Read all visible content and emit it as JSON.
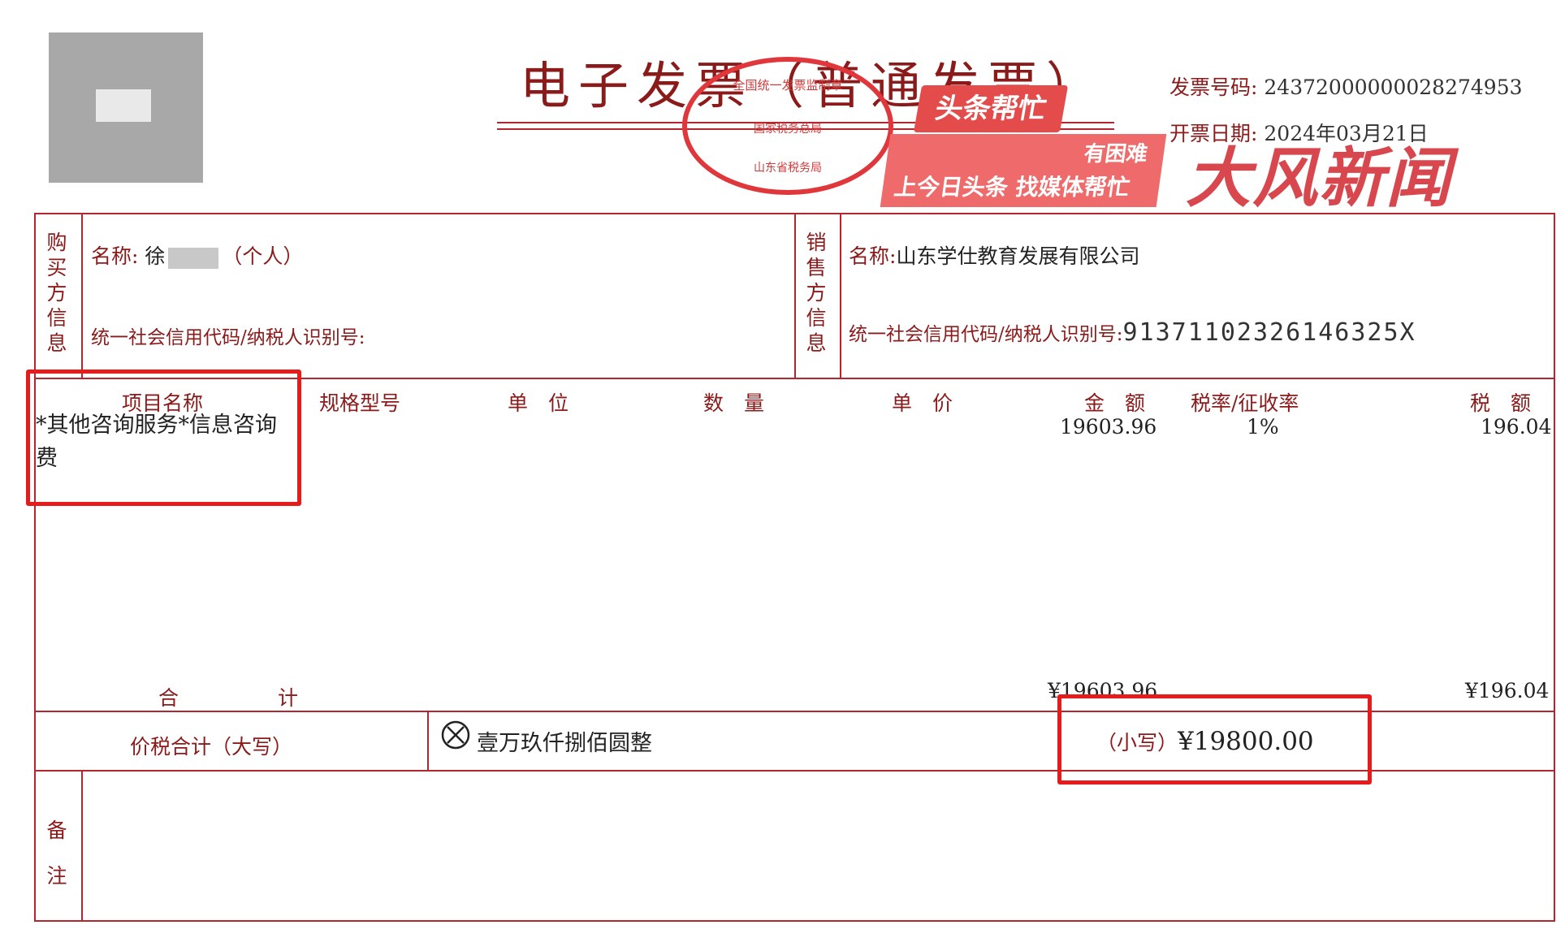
{
  "header": {
    "title": "电子发票（普通发票）",
    "invoice_no_label": "发票号码:",
    "invoice_no": "24372000000028274953",
    "issue_date_label": "开票日期:",
    "issue_date": "2024年03月21日"
  },
  "seal": {
    "line1": "全国统一发票监制章",
    "line2": "国家税务总局",
    "line3": "山东省税务局"
  },
  "watermark": {
    "badge": "头条帮忙",
    "line1": "有困难",
    "line2": "上今日头条 找媒体帮忙",
    "brand": "大风新闻"
  },
  "buyer": {
    "section_label": [
      "购",
      "买",
      "方",
      "信",
      "息"
    ],
    "name_label": "名称:",
    "name_prefix": "徐",
    "name_suffix": "（个人）",
    "tax_id_label": "统一社会信用代码/纳税人识别号:"
  },
  "seller": {
    "section_label": [
      "销",
      "售",
      "方",
      "信",
      "息"
    ],
    "name_label": "名称:",
    "name": "山东学仕教育发展有限公司",
    "tax_id_label": "统一社会信用代码/纳税人识别号:",
    "tax_id": "91371102326146325X"
  },
  "columns": {
    "item": "项目名称",
    "spec": "规格型号",
    "unit": "单　位",
    "qty": "数　量",
    "price": "单　价",
    "amount": "金　额",
    "rate": "税率/征收率",
    "tax": "税　额"
  },
  "items": [
    {
      "name_line1": "*其他咨询服务*信息咨询",
      "name_line2": "费",
      "amount": "19603.96",
      "rate": "1%",
      "tax": "196.04"
    }
  ],
  "totals": {
    "label_he": "合",
    "label_ji": "计",
    "amount": "¥19603.96",
    "tax": "¥196.04"
  },
  "grand_total": {
    "label": "价税合计（大写）",
    "in_words": "壹万玖仟捌佰圆整",
    "small_label": "（小写）",
    "small_value": "¥19800.00"
  },
  "remarks": {
    "label": [
      "备",
      "注"
    ]
  },
  "colors": {
    "border": "#b3262f",
    "highlight": "#e61c1c"
  }
}
